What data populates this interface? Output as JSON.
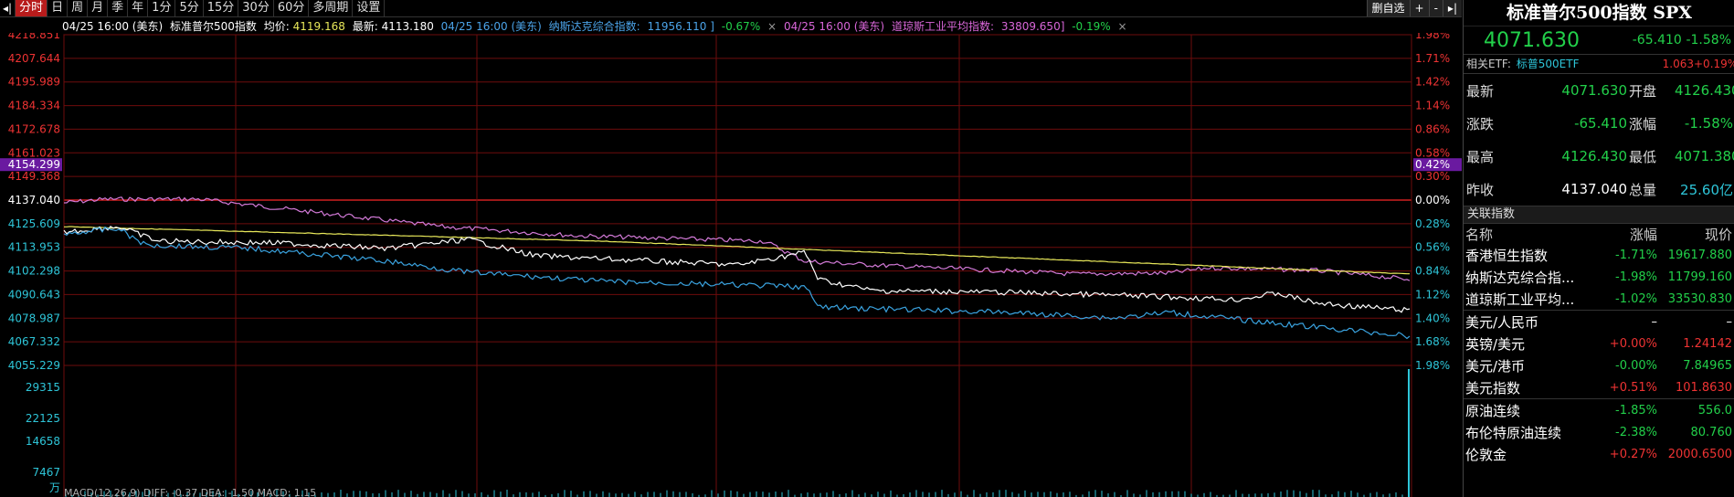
{
  "toolbar": {
    "left_icon": "◂|",
    "periods": [
      "分时",
      "日",
      "周",
      "月",
      "季",
      "年",
      "1分",
      "5分",
      "15分",
      "30分",
      "60分",
      "多周期",
      "设置"
    ],
    "active_index": 0,
    "right_buttons": {
      "watchlist": "删自选",
      "add": "+",
      "minus": "-",
      "collapse": "▸|"
    }
  },
  "infobar": {
    "spx_time": "04/25 16:00 (美东)",
    "spx_name": "标准普尔500指数",
    "avg_label": "均价:",
    "avg_value": "4119.168",
    "latest_label": "最新:",
    "latest_value": "4113.180",
    "ixic_time": "04/25 16:00 (美东)",
    "ixic_label": "纳斯达克综合指数:",
    "ixic_value": "11956.110 ]",
    "ixic_pct": "-0.67%",
    "dji_time": "04/25 16:00 (美东)",
    "dji_label": "道琼斯工业平均指数:",
    "dji_value": "33809.650]",
    "dji_pct": "-0.19%",
    "close_glyph": "×"
  },
  "chart_data": {
    "type": "line",
    "left_axis_labels": [
      "4218.851",
      "4207.644",
      "4195.989",
      "4184.334",
      "4172.678",
      "4161.023",
      "4149.368",
      "4137.040",
      "4125.609",
      "4113.953",
      "4102.298",
      "4090.643",
      "4078.987",
      "4067.332",
      "4055.229"
    ],
    "right_axis_labels": [
      "1.98%",
      "1.71%",
      "1.42%",
      "1.14%",
      "0.86%",
      "0.58%",
      "0.30%",
      "0.00%",
      "0.28%",
      "0.56%",
      "0.84%",
      "1.12%",
      "1.40%",
      "1.68%",
      "1.98%"
    ],
    "highlight_price": "4154.299",
    "highlight_pct": "0.42%",
    "volume_labels": [
      "29315",
      "22125",
      "14658",
      "7467",
      "万"
    ],
    "bottom_text": "MACD(12,26,9)  DIFF: -0.37  DEA: -1.50  MACD: 1.15"
  },
  "panel": {
    "title": "标准普尔500指数 SPX",
    "price": "4071.630",
    "change": "-65.410",
    "change_pct": "-1.58%",
    "etf_label": "相关ETF:",
    "etf_name": "标普500ETF",
    "etf_price": "1.063",
    "etf_pct": "+0.19%",
    "quotes": [
      {
        "l1": "最新",
        "v1": "4071.630",
        "c1": "green",
        "l2": "开盘",
        "v2": "4126.430",
        "c2": "green"
      },
      {
        "l1": "涨跌",
        "v1": "-65.410",
        "c1": "green",
        "l2": "涨幅",
        "v2": "-1.58%",
        "c2": "green"
      },
      {
        "l1": "最高",
        "v1": "4126.430",
        "c1": "green",
        "l2": "最低",
        "v2": "4071.380",
        "c2": "green"
      },
      {
        "l1": "昨收",
        "v1": "4137.040",
        "c1": "white",
        "l2": "总量",
        "v2": "25.60亿",
        "c2": "cyan"
      }
    ],
    "related_header": "关联指数",
    "related_cols": {
      "name": "名称",
      "pct": "涨幅",
      "price": "现价"
    },
    "related": [
      {
        "name": "香港恒生指数",
        "pct": "-1.71%",
        "price": "19617.880",
        "color": "green"
      },
      {
        "name": "纳斯达克综合指...",
        "pct": "-1.98%",
        "price": "11799.160",
        "color": "green"
      },
      {
        "name": "道琼斯工业平均...",
        "pct": "-1.02%",
        "price": "33530.830",
        "color": "green"
      },
      {
        "name": "美元/人民币",
        "pct": "–",
        "price": "–",
        "color": "white"
      },
      {
        "name": "英镑/美元",
        "pct": "+0.00%",
        "price": "1.24142",
        "color": "red"
      },
      {
        "name": "美元/港币",
        "pct": "-0.00%",
        "price": "7.84965",
        "color": "green"
      },
      {
        "name": "美元指数",
        "pct": "+0.51%",
        "price": "101.8630",
        "color": "red"
      },
      {
        "name": "原油连续",
        "pct": "-1.85%",
        "price": "556.0",
        "color": "green"
      },
      {
        "name": "布伦特原油连续",
        "pct": "-2.38%",
        "price": "80.760",
        "color": "green"
      },
      {
        "name": "伦敦金",
        "pct": "+0.27%",
        "price": "2000.6500",
        "color": "red"
      }
    ]
  }
}
